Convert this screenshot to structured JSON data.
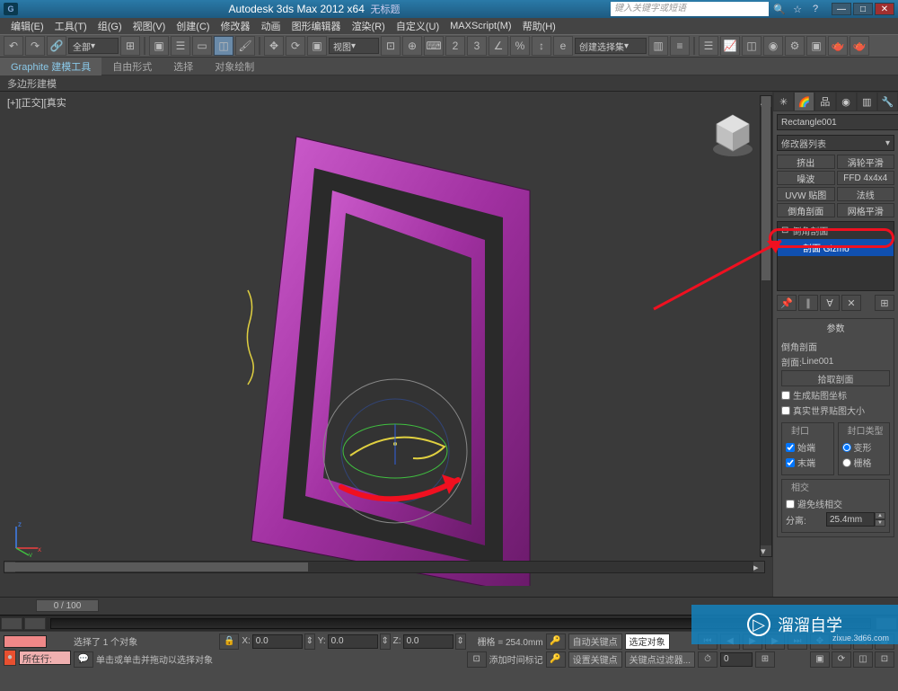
{
  "title": {
    "app": "Autodesk 3ds Max  2012  x64",
    "doc": "无标题"
  },
  "search_placeholder": "键入关键字或短语",
  "menu": [
    "编辑(E)",
    "工具(T)",
    "组(G)",
    "视图(V)",
    "创建(C)",
    "修改器",
    "动画",
    "图形编辑器",
    "渲染(R)",
    "自定义(U)",
    "MAXScript(M)",
    "帮助(H)"
  ],
  "toolbar1_all": "全部",
  "toolbar1_view": "视图",
  "toolbar1_createsel": "创建选择集",
  "ribbon": {
    "tabs": [
      "Graphite 建模工具",
      "自由形式",
      "选择",
      "对象绘制"
    ],
    "sub": "多边形建模"
  },
  "viewport_label": "[+][正交][真实",
  "command_panel": {
    "object_name": "Rectangle001",
    "modifier_list": "修改器列表",
    "mod_buttons": [
      "挤出",
      "涡轮平滑",
      "噪波",
      "FFD 4x4x4",
      "UVW 贴图",
      "法线",
      "倒角剖面",
      "网格平滑"
    ],
    "stack": {
      "top": "倒角剖面",
      "gizmo": "剖面 Gizmo"
    },
    "params_title": "参数",
    "bevel_profile": "倒角剖面",
    "profile_label": "剖面:",
    "profile_value": "Line001",
    "pick_profile": "拾取剖面",
    "gen_mapping": "生成贴图坐标",
    "real_world": "真实世界贴图大小",
    "capping": {
      "title": "封口",
      "start": "始端",
      "end": "末端"
    },
    "cap_type": {
      "title": "封口类型",
      "morph": "变形",
      "grid": "栅格"
    },
    "intersect": {
      "title": "相交",
      "avoid": "避免线相交",
      "sep_label": "分离:",
      "sep_value": "25.4mm"
    }
  },
  "timeline": {
    "label": "0 / 100"
  },
  "status": {
    "sel": "选择了 1 个对象",
    "hint": "单击或单击并拖动以选择对象",
    "addkey": "添加时间标记",
    "x": "0.0",
    "y": "0.0",
    "z": "0.0",
    "grid": "栅格 = 254.0mm",
    "here": "所在行:",
    "autokey": "自动关键点",
    "setkey": "设置关键点",
    "selset": "选定对象",
    "keyfilter": "关键点过滤器..."
  },
  "watermark": {
    "text": "溜溜自学",
    "url": "zixue.3d66.com"
  }
}
